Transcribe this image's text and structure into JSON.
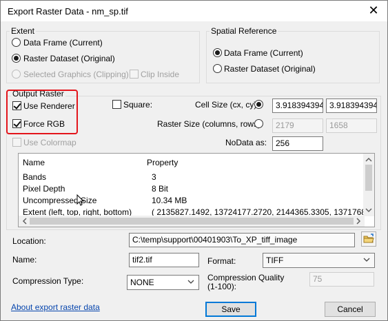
{
  "window": {
    "title": "Export Raster Data - nm_sp.tif",
    "close": "✕"
  },
  "extent": {
    "legend": "Extent",
    "opt_data_frame": "Data Frame (Current)",
    "opt_raster_dataset": "Raster Dataset (Original)",
    "opt_selected_graphics": "Selected Graphics (Clipping)",
    "clip_inside": "Clip Inside",
    "selected": "Raster Dataset (Original)"
  },
  "spatial_reference": {
    "legend": "Spatial Reference",
    "opt_data_frame": "Data Frame (Current)",
    "opt_raster_dataset": "Raster Dataset (Original)",
    "selected": "Data Frame (Current)"
  },
  "output_raster": {
    "legend": "Output Raster",
    "use_renderer": "Use Renderer",
    "use_renderer_checked": true,
    "force_rgb": "Force RGB",
    "force_rgb_checked": true,
    "use_colormap": "Use Colormap",
    "use_colormap_checked": false,
    "square": "Square:",
    "cell_size_label": "Cell Size (cx, cy):",
    "cell_cx": "3.918394394",
    "cell_cy": "3.918394394",
    "raster_size_label": "Raster Size (columns, rows):",
    "raster_columns": "2179",
    "raster_rows": "1658",
    "nodata_label": "NoData as:",
    "nodata_value": "256"
  },
  "properties": {
    "headers": [
      "Name",
      "Property"
    ],
    "rows": [
      [
        "Bands",
        "3"
      ],
      [
        "Pixel Depth",
        "8 Bit"
      ],
      [
        "Uncompressed Size",
        "10.34 MB"
      ],
      [
        "Extent (left, top, right, bottom)",
        "( 2135827.1492, 13724177.2720, 2144365.3305, 13717680.57..."
      ]
    ]
  },
  "location": {
    "label": "Location:",
    "value": "C:\\temp\\support\\00401903\\To_XP_tiff_image"
  },
  "name": {
    "label": "Name:",
    "value": "tif2.tif"
  },
  "format": {
    "label": "Format:",
    "value": "TIFF"
  },
  "compression_type": {
    "label": "Compression Type:",
    "value": "NONE"
  },
  "compression_quality": {
    "label": "Compression Quality\n(1-100):",
    "value": "75"
  },
  "footer": {
    "about_link": "About export raster data",
    "save": "Save",
    "cancel": "Cancel"
  },
  "colors": {
    "highlight": "#e3141b",
    "link": "#0645ad",
    "default_button_border": "#0078d7"
  },
  "icons": {
    "browse": "folder-icon",
    "close": "close-icon"
  }
}
